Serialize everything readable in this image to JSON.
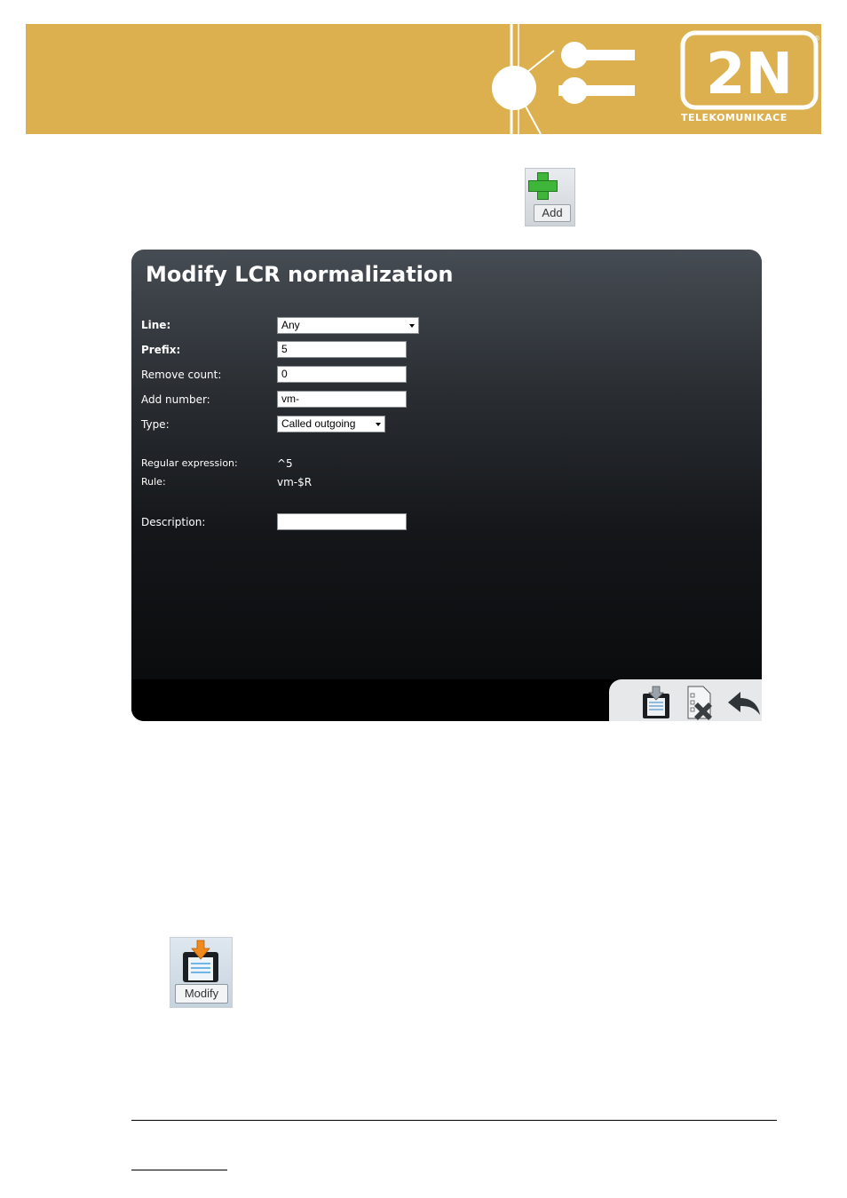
{
  "header": {
    "logo_text": "TELEKOMUNIKACE",
    "logo_mark": "2N",
    "registered_mark": "®"
  },
  "add_button": {
    "label": "Add",
    "icon": "plus-icon"
  },
  "dialog": {
    "title": "Modify LCR normalization",
    "fields": {
      "line_label": "Line:",
      "line_value": "Any",
      "prefix_label": "Prefix:",
      "prefix_value": "5",
      "remove_count_label": "Remove count:",
      "remove_count_value": "0",
      "add_number_label": "Add number:",
      "add_number_value": "vm-",
      "type_label": "Type:",
      "type_value": "Called outgoing",
      "regex_label": "Regular expression:",
      "regex_value": "^5",
      "rule_label": "Rule:",
      "rule_value": "vm-$R",
      "description_label": "Description:",
      "description_value": ""
    },
    "toolbar": [
      "save-icon",
      "delete-icon",
      "back-icon"
    ]
  },
  "modify_button": {
    "label": "Modify",
    "icon": "save-icon"
  },
  "colors": {
    "banner": "#dcb04e",
    "dialog_top": "#464c53",
    "dialog_bottom": "#08090a",
    "add_green": "#3fb53a"
  }
}
